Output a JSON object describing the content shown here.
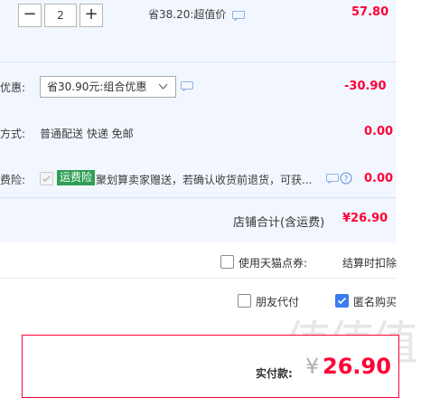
{
  "item": {
    "quantity": "2",
    "decrement_label": "−",
    "increment_label": "+",
    "promo_text": "省38.20:超值价",
    "price": "57.80"
  },
  "discount": {
    "label": "优惠:",
    "selected": "省30.90元:组合优惠",
    "amount": "-30.90"
  },
  "shipping": {
    "label": "方式:",
    "value": "普通配送 快递 免邮",
    "amount": "0.00"
  },
  "insurance": {
    "label": "费险:",
    "badge": "运费险",
    "text": "聚划算卖家赠送，若确认收货前退货，可获...",
    "amount": "0.00"
  },
  "subtotal": {
    "label": "店铺合计(含运费)",
    "value": "¥26.90"
  },
  "points": {
    "label": "使用天猫点券:",
    "note": "结算时扣除"
  },
  "options": {
    "friend_pay": "朋友代付",
    "anonymous": "匿名购买"
  },
  "payment": {
    "label": "实付款:",
    "currency": "¥",
    "amount": "26.90"
  },
  "colors": {
    "accent_red": "#ff0036",
    "panel_blue": "#f2f7ff",
    "checkbox_blue": "#3a7cf1",
    "badge_green": "#2f9e55"
  }
}
